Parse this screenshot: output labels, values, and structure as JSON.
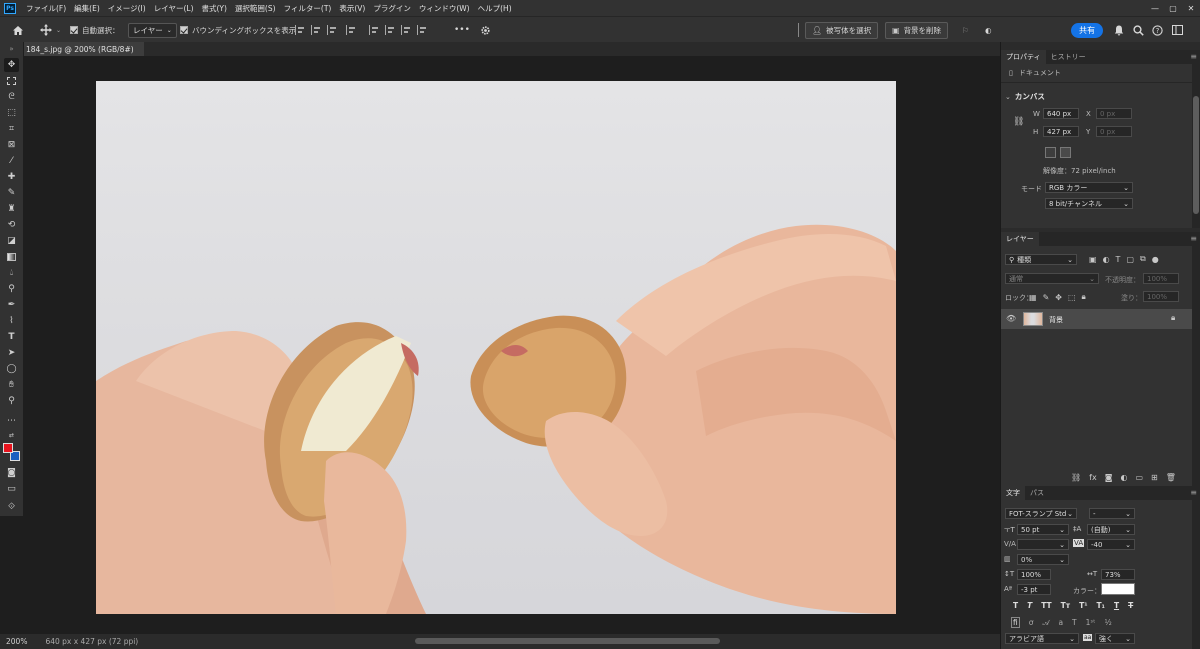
{
  "app": {
    "logo": "Ps"
  },
  "menu": [
    "ファイル(F)",
    "編集(E)",
    "イメージ(I)",
    "レイヤー(L)",
    "書式(Y)",
    "選択範囲(S)",
    "フィルター(T)",
    "表示(V)",
    "プラグイン",
    "ウィンドウ(W)",
    "ヘルプ(H)"
  ],
  "window_controls": {
    "minimize": "—",
    "maximize": "▢",
    "close": "✕"
  },
  "options": {
    "auto_select_label": "自動選択：",
    "auto_select_target": "レイヤー",
    "bounding_box_label": "バウンディングボックスを表示",
    "more": "•••",
    "select_subject": "被写体を選択",
    "remove_bg": "背景を削除",
    "share": "共有"
  },
  "document": {
    "tab_title": "184_s.jpg @ 200% (RGB/8#)"
  },
  "status": {
    "zoom": "200%",
    "doc_info": "640 px x 427 px (72 ppi)",
    "arrow": "›",
    "scroll_left": "‹"
  },
  "properties": {
    "tabs": [
      "プロパティ",
      "ヒストリー"
    ],
    "doc_label": "ドキュメント",
    "canvas_section": "カンバス",
    "w_label": "W",
    "w_value": "640 px",
    "h_label": "H",
    "h_value": "427 px",
    "x_label": "X",
    "x_value": "0 px",
    "y_label": "Y",
    "y_value": "0 px",
    "resolution": "解像度：72 pixel/inch",
    "mode_label": "モード",
    "mode_value": "RGB カラー",
    "bit_value": "8 bit/チャンネル"
  },
  "layers": {
    "tab": "レイヤー",
    "filter_kind": "種類",
    "blend_mode": "通常",
    "opacity_label": "不透明度：",
    "opacity_value": "100%",
    "lock_label": "ロック：",
    "fill_label": "塗り：",
    "fill_value": "100%",
    "layer_name": "背景"
  },
  "character": {
    "tabs": [
      "文字",
      "パス"
    ],
    "font_family": "FOT-スランプ Std",
    "font_style": "-",
    "font_size": "50 pt",
    "leading": "(自動)",
    "kerning": "",
    "tracking": "-40",
    "tsume": "0%",
    "v_scale": "100%",
    "h_scale": "73%",
    "baseline": "-3 pt",
    "color_label": "カラー：",
    "language": "アラビア語",
    "antialias": "強く",
    "va_label": "V/A"
  },
  "colors": {
    "accent": "#1473e6",
    "fg_swatch": "#e8141e",
    "bg_swatch": "#1a5fc0"
  }
}
